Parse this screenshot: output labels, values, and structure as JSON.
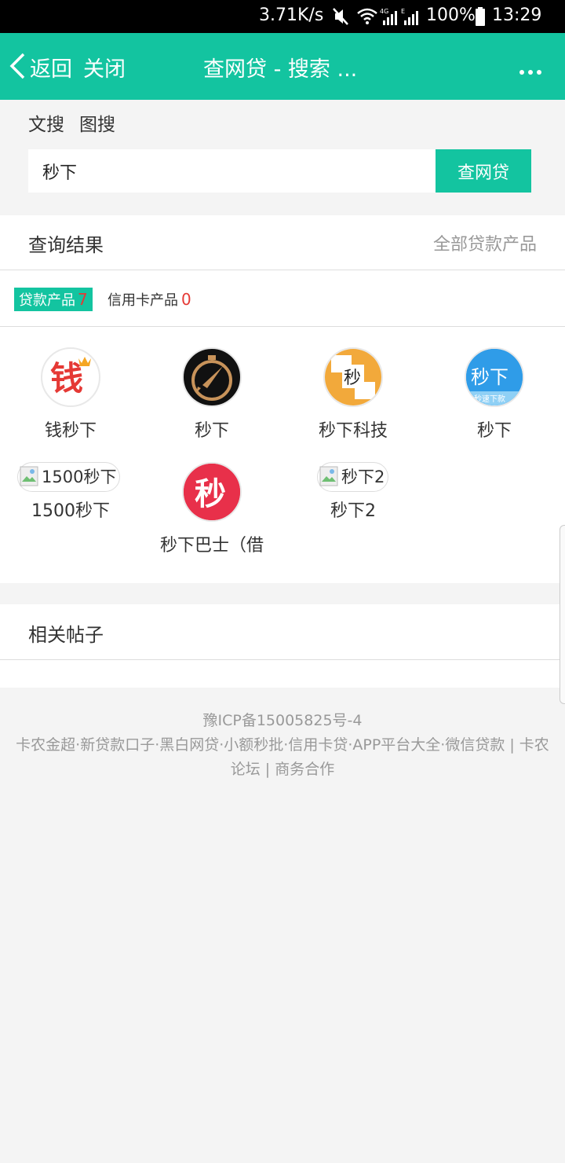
{
  "status_bar": {
    "speed": "3.71K/s",
    "battery": "100%",
    "time": "13:29",
    "icons": [
      "mute-icon",
      "wifi-icon",
      "signal-4g-icon",
      "signal-e-icon",
      "battery-icon"
    ]
  },
  "header": {
    "back_label": "返回",
    "close_label": "关闭",
    "title": "查网贷 - 搜索 ...",
    "more_icon": "more-dots-icon",
    "color": "#13c4a0"
  },
  "search": {
    "tabs": [
      "文搜",
      "图搜"
    ],
    "query": "秒下",
    "button_label": "查网贷"
  },
  "results": {
    "title": "查询结果",
    "all_link": "全部贷款产品",
    "filters": {
      "loan_label": "贷款产品",
      "loan_count": "7",
      "card_label": "信用卡产品",
      "card_count": "0"
    },
    "products": [
      {
        "name": "钱秒下",
        "logo_text": "钱"
      },
      {
        "name": "秒下",
        "logo_text": ""
      },
      {
        "name": "秒下科技",
        "logo_text": "秒"
      },
      {
        "name": "秒下",
        "logo_text": "秒下",
        "logo_sub": "秒速下款"
      },
      {
        "name": "1500秒下",
        "alt": "1500秒下"
      },
      {
        "name": "秒下巴士（借",
        "logo_text": "秒"
      },
      {
        "name": "秒下2",
        "alt": "秒下2"
      }
    ]
  },
  "posts": {
    "title": "相关帖子"
  },
  "footer": {
    "icp": "豫ICP备15005825号-4",
    "links_line1": "卡农金超·新贷款口子·黑白网贷·小额秒批·信用卡贷·APP平台大全·微信贷款 | 卡农",
    "links_line2": "论坛 | 商务合作"
  }
}
